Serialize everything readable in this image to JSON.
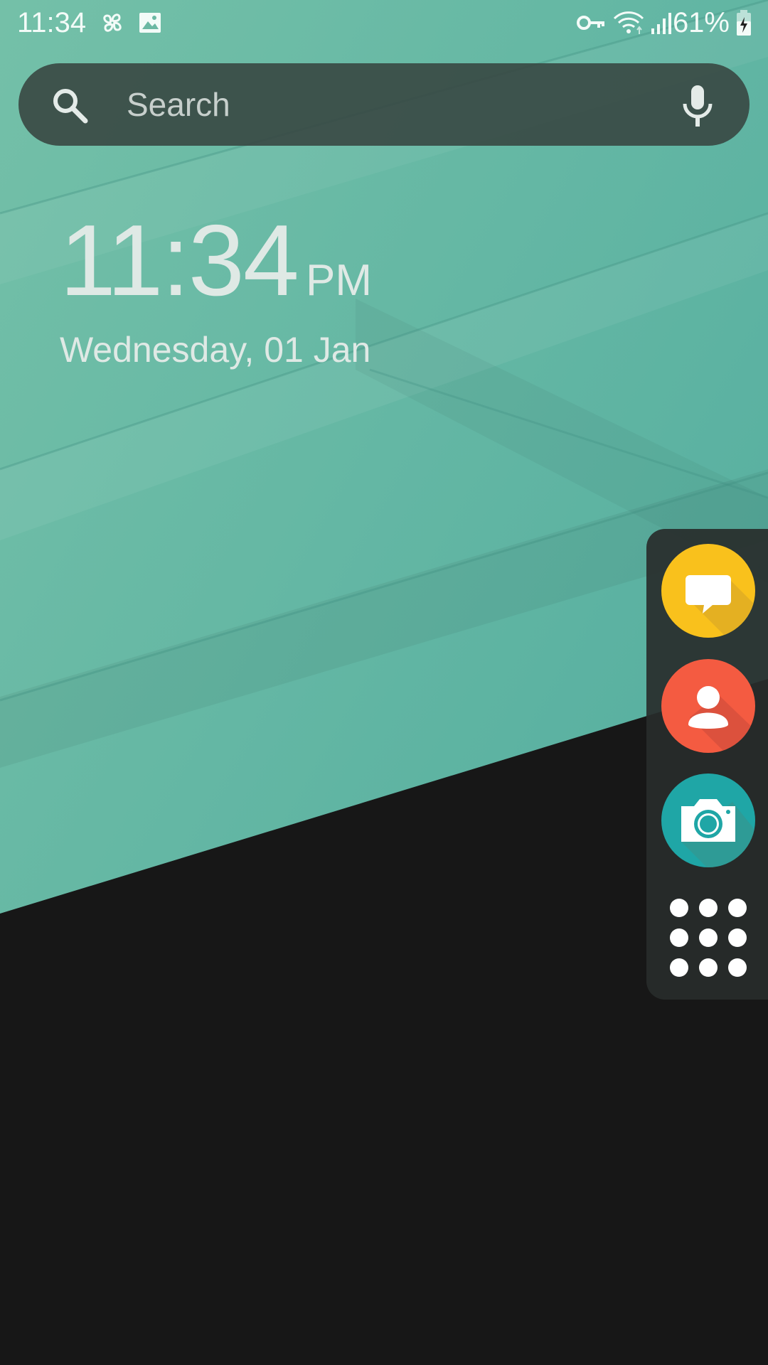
{
  "status_bar": {
    "time": "11:34",
    "battery": "61%",
    "icons": [
      "pinwheel-icon",
      "image-icon",
      "vpn-key-icon",
      "wifi-icon",
      "signal-icon",
      "battery-icon"
    ]
  },
  "search": {
    "placeholder": "Search",
    "search_icon": "search-icon",
    "mic_icon": "mic-icon"
  },
  "clock": {
    "time": "11:34",
    "ampm": "PM",
    "date": "Wednesday, 01 Jan"
  },
  "dock": {
    "apps": [
      {
        "name": "messages",
        "icon": "message-icon",
        "color": "#f9c11c"
      },
      {
        "name": "contacts",
        "icon": "contact-icon",
        "color": "#f45b41"
      },
      {
        "name": "camera",
        "icon": "camera-icon",
        "color": "#1fa6a6"
      }
    ],
    "app_drawer_icon": "app-grid-icon"
  },
  "colors": {
    "wallpaper_teal": "#6bb8a3",
    "wallpaper_dark": "#171717"
  }
}
